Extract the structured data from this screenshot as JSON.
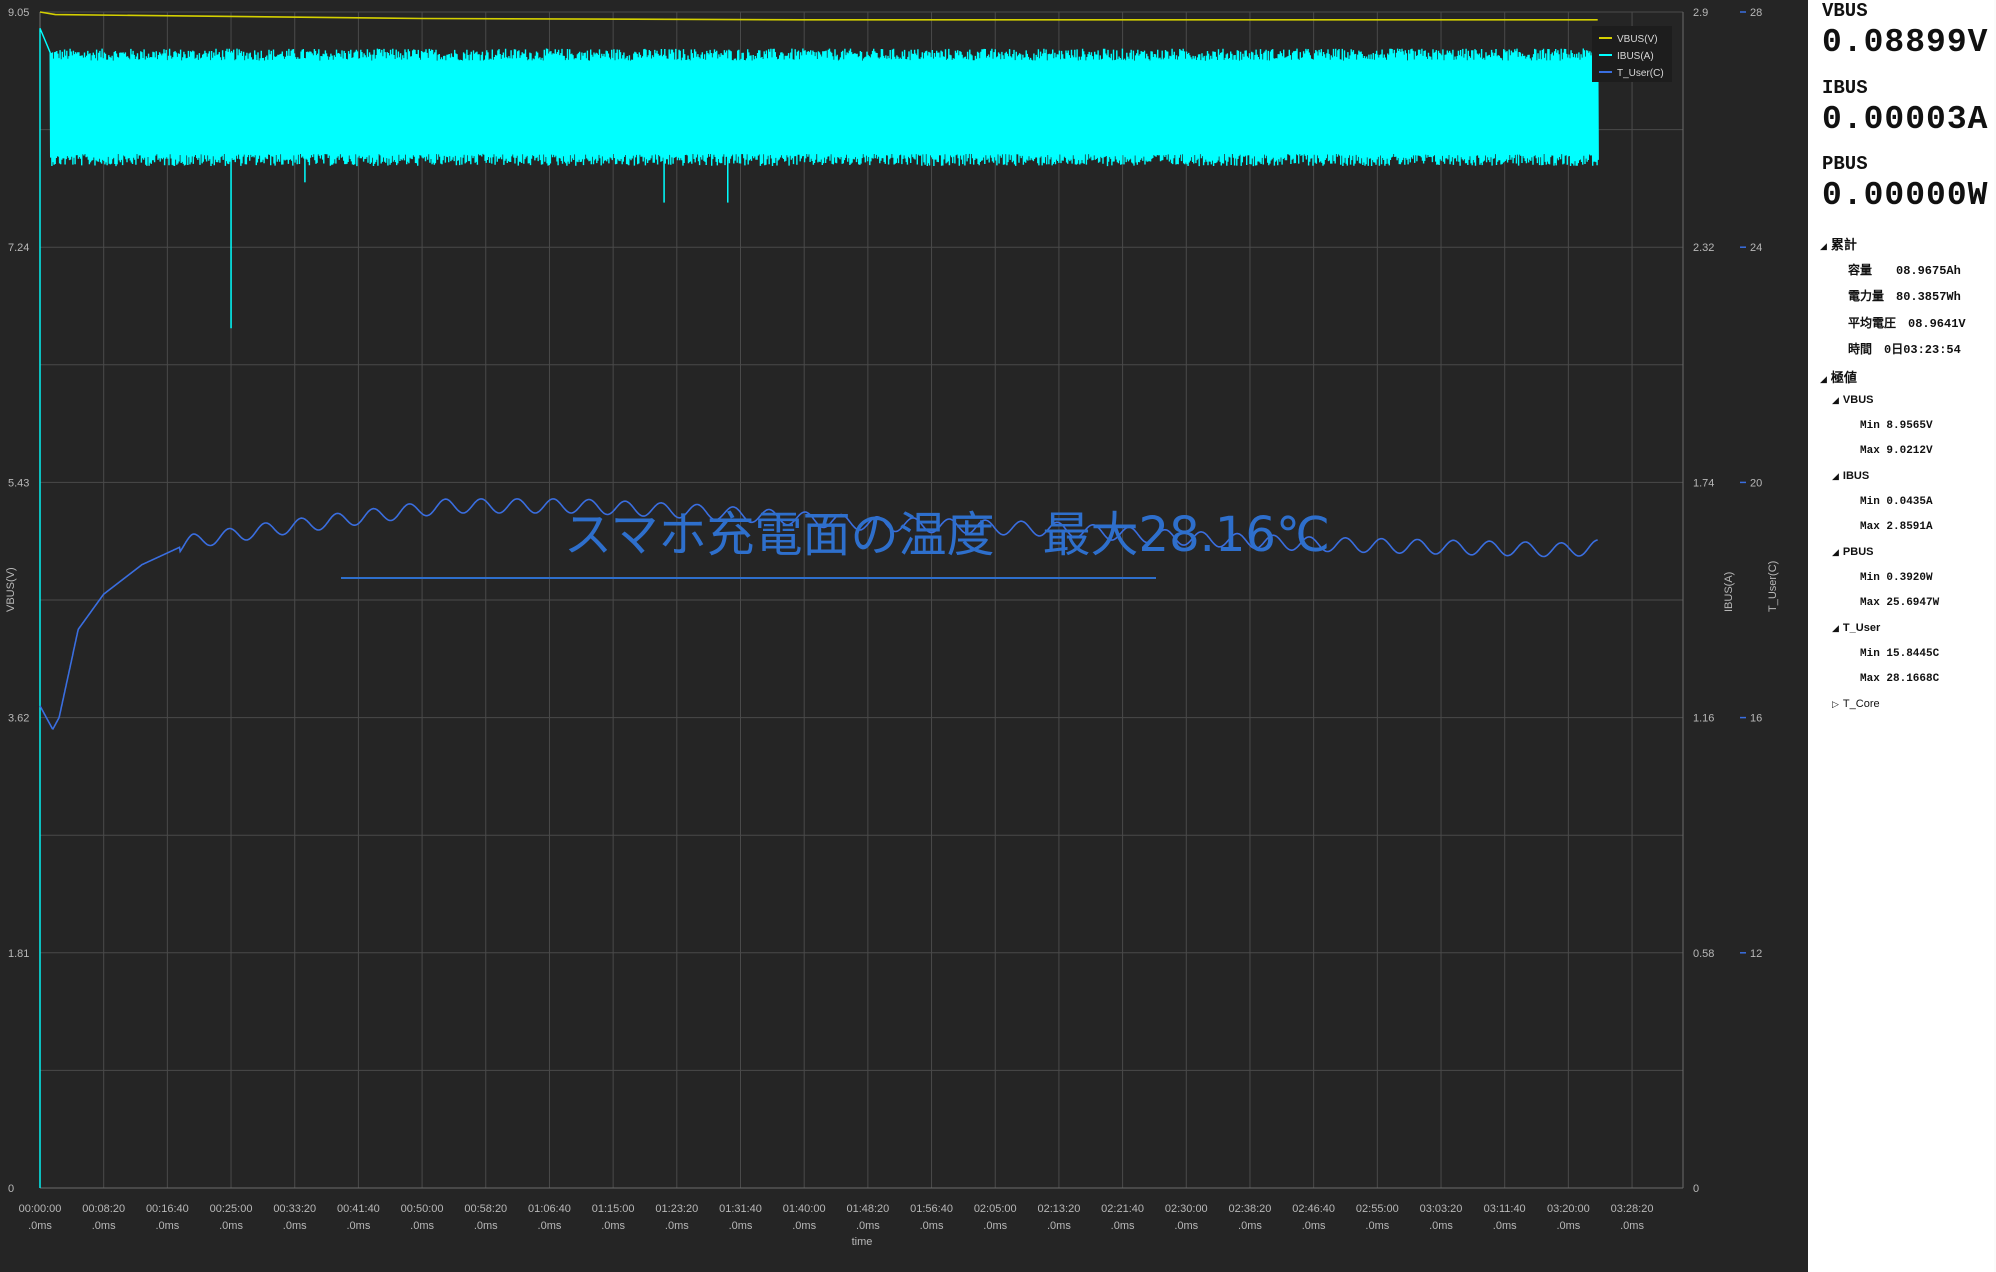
{
  "chart_data": {
    "type": "line",
    "xlabel": "time",
    "x_ticks": [
      "00:00:00",
      "00:08:20",
      "00:16:40",
      "00:25:00",
      "00:33:20",
      "00:41:40",
      "00:50:00",
      "00:58:20",
      "01:06:40",
      "01:15:00",
      "01:23:20",
      "01:31:40",
      "01:40:00",
      "01:48:20",
      "01:56:40",
      "02:05:00",
      "02:13:20",
      "02:21:40",
      "02:30:00",
      "02:38:20",
      "02:46:40",
      "02:55:00",
      "03:03:20",
      "03:11:40",
      "03:20:00",
      "03:28:20"
    ],
    "x_tick_sub": ".0ms",
    "left_axis": {
      "label": "VBUS(V)",
      "ticks": [
        "0",
        "1.81",
        "3.62",
        "5.43",
        "7.24",
        "9.05"
      ],
      "ylim": [
        0,
        9.05
      ]
    },
    "mid_axis": {
      "label": "IBUS(A)",
      "ticks": [
        "0",
        "0.58",
        "1.16",
        "1.74",
        "2.32",
        "2.9"
      ],
      "ylim": [
        0,
        2.9
      ]
    },
    "right_axis": {
      "label": "T_User(C)",
      "ticks": [
        "12",
        "16",
        "20",
        "24",
        "28"
      ],
      "ylim": [
        8,
        28
      ]
    },
    "xlim_seconds": [
      0,
      12900
    ],
    "series": [
      {
        "name": "VBUS(V)",
        "color": "#d4d000",
        "axis": "left",
        "points": [
          [
            0,
            9.05
          ],
          [
            120,
            9.03
          ],
          [
            3000,
            9.0
          ],
          [
            6000,
            8.99
          ],
          [
            9000,
            8.99
          ],
          [
            12230,
            8.99
          ]
        ]
      },
      {
        "name": "IBUS(A)",
        "color": "#00ffff",
        "axis": "mid",
        "band_low": 2.55,
        "band_high": 2.78,
        "band_end": 12230,
        "spikes": [
          [
            1500,
            2.12
          ],
          [
            2080,
            2.48
          ],
          [
            4900,
            2.43
          ],
          [
            5400,
            2.43
          ]
        ]
      },
      {
        "name": "T_User(C)",
        "color": "#3a6ee0",
        "axis": "right",
        "points": [
          [
            0,
            16.2
          ],
          [
            100,
            15.8
          ],
          [
            150,
            16.0
          ],
          [
            300,
            17.5
          ],
          [
            500,
            18.1
          ],
          [
            800,
            18.6
          ],
          [
            1200,
            19.0
          ],
          [
            1800,
            19.2
          ],
          [
            2500,
            19.4
          ],
          [
            3200,
            19.6
          ],
          [
            4200,
            19.6
          ],
          [
            5200,
            19.5
          ],
          [
            6500,
            19.3
          ],
          [
            8000,
            19.2
          ],
          [
            9000,
            19.05
          ],
          [
            10000,
            18.95
          ],
          [
            11000,
            18.9
          ],
          [
            12000,
            18.85
          ],
          [
            12230,
            18.9
          ]
        ]
      }
    ],
    "annotation": {
      "text": "スマホ充電面の温度　最大28.16℃",
      "color": "#2e6fcc"
    }
  },
  "panel": {
    "vbus_label": "VBUS",
    "vbus_value": "0.08899V",
    "ibus_label": "IBUS",
    "ibus_value": "0.00003A",
    "pbus_label": "PBUS",
    "pbus_value": "0.00000W",
    "cumulative_label": "累計",
    "capacity": "容量　　08.9675Ah",
    "energy": "電力量　80.3857Wh",
    "avg_voltage": "平均電圧　08.9641V",
    "time": "時間　0日03:23:54",
    "extremes_label": "極値",
    "vbus_group": "VBUS",
    "vbus_min": "Min 8.9565V",
    "vbus_max": "Max 9.0212V",
    "ibus_group": "IBUS",
    "ibus_min": "Min 0.0435A",
    "ibus_max": "Max 2.8591A",
    "pbus_group": "PBUS",
    "pbus_min": "Min 0.3920W",
    "pbus_max": "Max 25.6947W",
    "tuser_group": "T_User",
    "tuser_min": "Min 15.8445C",
    "tuser_max": "Max 28.1668C",
    "tcore_group": "T_Core"
  }
}
